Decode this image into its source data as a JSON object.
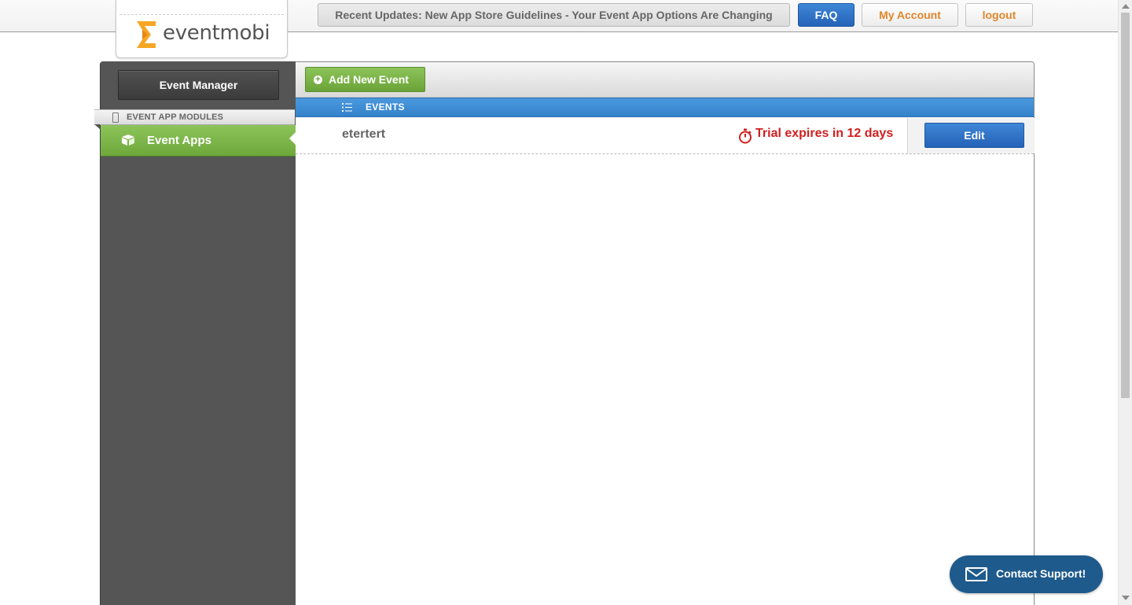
{
  "header": {
    "logo_text": "eventmobi",
    "news_label": "Recent Updates: New App Store Guidelines - Your Event App Options Are Changing",
    "faq_label": "FAQ",
    "account_label": "My Account",
    "logout_label": "logout",
    "colors": {
      "accent_blue": "#2d74c6",
      "accent_orange": "#e0862a",
      "logo_orange": "#f5a623"
    }
  },
  "sidebar": {
    "event_manager_label": "Event Manager",
    "section_label": "EVENT APP MODULES",
    "items": [
      {
        "label": "Event Apps",
        "icon": "cube-icon",
        "active": true
      }
    ],
    "colors": {
      "active_green": "#7db64a",
      "background": "#555555"
    }
  },
  "main": {
    "add_event_label": "Add New Event",
    "events_header": "EVENTS",
    "events": [
      {
        "name": "etertert",
        "status": "Trial expires in 12 days",
        "action_label": "Edit"
      }
    ]
  },
  "support": {
    "label": "Contact Support!"
  }
}
